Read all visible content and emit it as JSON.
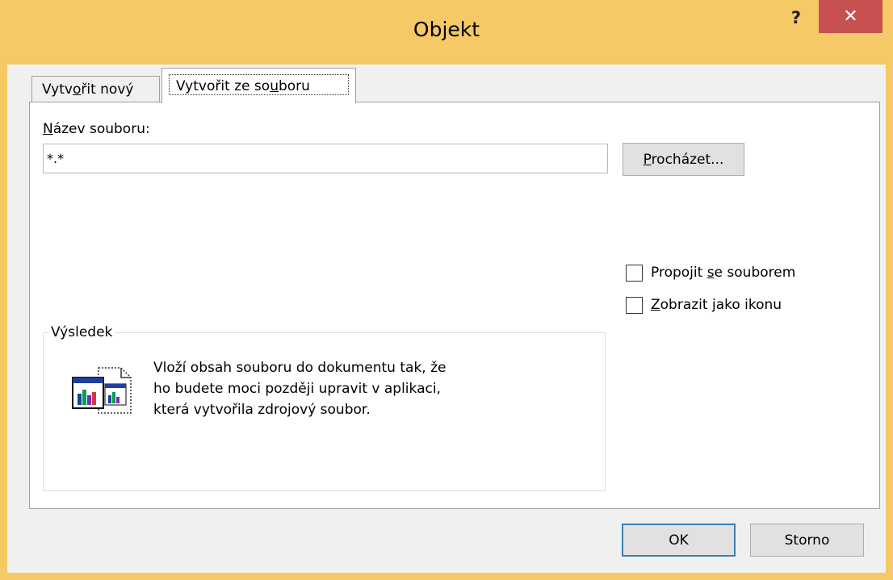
{
  "window": {
    "title": "Objekt",
    "help_glyph": "?",
    "close_glyph": "✕"
  },
  "tabs": [
    {
      "pre": "Vytv",
      "key": "o",
      "post": "řit nový",
      "selected": false
    },
    {
      "pre": "Vytvořit ze so",
      "key": "u",
      "post": "boru",
      "selected": true
    }
  ],
  "file": {
    "label_key": "N",
    "label_rest": "ázev souboru:",
    "value": "*.*",
    "browse_key": "P",
    "browse_rest": "rocházet..."
  },
  "options": {
    "link": {
      "pre": "Propojit ",
      "key": "s",
      "post": "e souborem",
      "checked": false
    },
    "icon": {
      "pre": "",
      "key": "Z",
      "post": "obrazit jako ikonu",
      "checked": false
    }
  },
  "result": {
    "legend": "Výsledek",
    "lines": [
      "Vloží obsah souboru do dokumentu tak, že",
      "ho budete moci později upravit v aplikaci,",
      "která vytvořila zdrojový soubor."
    ],
    "icon": "embedded-document-icon"
  },
  "buttons": {
    "ok": "OK",
    "cancel": "Storno"
  },
  "colors": {
    "titlebar": "#f5c965",
    "close": "#c75050",
    "ok_border": "#3c7fb1"
  }
}
